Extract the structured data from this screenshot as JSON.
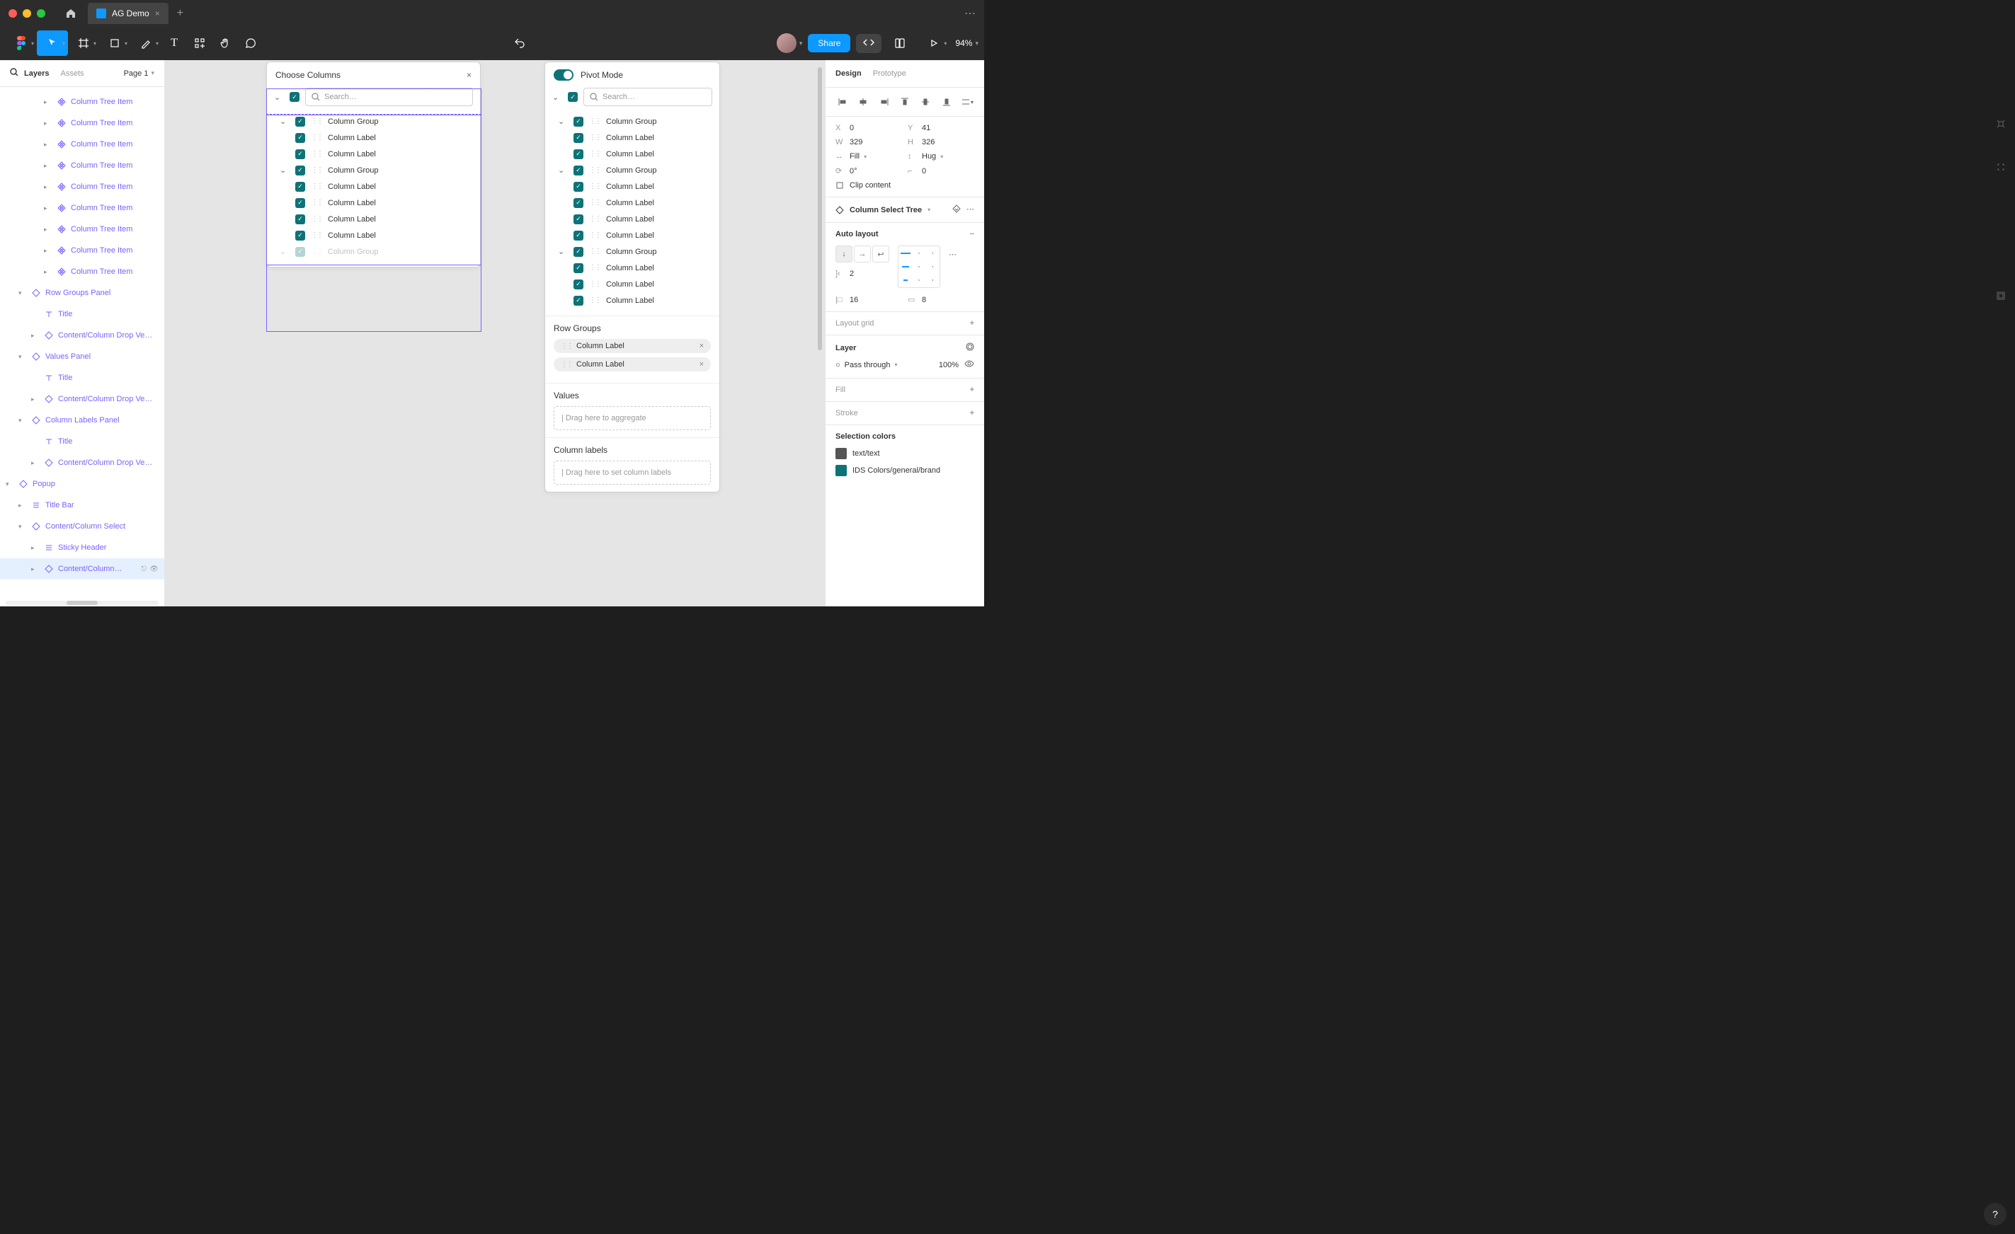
{
  "tab": {
    "title": "AG Demo"
  },
  "toolbar": {
    "share": "Share",
    "zoom": "94%"
  },
  "left_panel": {
    "tabs": {
      "layers": "Layers",
      "assets": "Assets"
    },
    "page": "Page 1",
    "layers": [
      {
        "indent": 3,
        "icon": "component",
        "label": "Column Tree Item",
        "caret": true
      },
      {
        "indent": 3,
        "icon": "component",
        "label": "Column Tree Item",
        "caret": true
      },
      {
        "indent": 3,
        "icon": "component",
        "label": "Column Tree Item",
        "caret": true
      },
      {
        "indent": 3,
        "icon": "component",
        "label": "Column Tree Item",
        "caret": true
      },
      {
        "indent": 3,
        "icon": "component",
        "label": "Column Tree Item",
        "caret": true
      },
      {
        "indent": 3,
        "icon": "component",
        "label": "Column Tree Item",
        "caret": true
      },
      {
        "indent": 3,
        "icon": "component",
        "label": "Column Tree Item",
        "caret": true
      },
      {
        "indent": 3,
        "icon": "component",
        "label": "Column Tree Item",
        "caret": true
      },
      {
        "indent": 3,
        "icon": "component",
        "label": "Column Tree Item",
        "caret": true
      },
      {
        "indent": 1,
        "icon": "frame-o",
        "label": "Row Groups Panel",
        "caret": true,
        "open": true
      },
      {
        "indent": 2,
        "icon": "text",
        "label": "Title"
      },
      {
        "indent": 2,
        "icon": "frame-o",
        "label": "Content/Column Drop Ve…",
        "caret": true
      },
      {
        "indent": 1,
        "icon": "frame-o",
        "label": "Values Panel",
        "caret": true,
        "open": true
      },
      {
        "indent": 2,
        "icon": "text",
        "label": "Title"
      },
      {
        "indent": 2,
        "icon": "frame-o",
        "label": "Content/Column Drop Ve…",
        "caret": true
      },
      {
        "indent": 1,
        "icon": "frame-o",
        "label": "Column Labels Panel",
        "caret": true,
        "open": true
      },
      {
        "indent": 2,
        "icon": "text",
        "label": "Title"
      },
      {
        "indent": 2,
        "icon": "frame-o",
        "label": "Content/Column Drop Ve…",
        "caret": true
      },
      {
        "indent": 0,
        "icon": "frame-o",
        "label": "Popup",
        "caret": true,
        "open": true
      },
      {
        "indent": 1,
        "icon": "autolayout",
        "label": "Title Bar",
        "caret": true
      },
      {
        "indent": 1,
        "icon": "frame-o",
        "label": "Content/Column Select",
        "caret": true,
        "open": true
      },
      {
        "indent": 2,
        "icon": "autolayout",
        "label": "Sticky Header",
        "caret": true
      },
      {
        "indent": 2,
        "icon": "frame-o",
        "label": "Content/Column…",
        "caret": true,
        "selected": true,
        "actions": true
      }
    ]
  },
  "canvas": {
    "choose_panel": {
      "title": "Choose Columns",
      "search_placeholder": "Search…",
      "rows": [
        {
          "type": "group",
          "label": "Column Group"
        },
        {
          "type": "item",
          "label": "Column Label"
        },
        {
          "type": "item",
          "label": "Column Label"
        },
        {
          "type": "group",
          "label": "Column Group"
        },
        {
          "type": "item",
          "label": "Column Label"
        },
        {
          "type": "item",
          "label": "Column Label"
        },
        {
          "type": "item",
          "label": "Column Label"
        },
        {
          "type": "item",
          "label": "Column Label"
        },
        {
          "type": "group_cut",
          "label": "Column Group"
        }
      ]
    },
    "pivot_panel": {
      "title": "Pivot Mode",
      "search_placeholder": "Search…",
      "rows": [
        {
          "type": "group",
          "label": "Column Group"
        },
        {
          "type": "item",
          "label": "Column Label"
        },
        {
          "type": "item",
          "label": "Column Label"
        },
        {
          "type": "group",
          "label": "Column Group"
        },
        {
          "type": "item",
          "label": "Column Label"
        },
        {
          "type": "item",
          "label": "Column Label"
        },
        {
          "type": "item",
          "label": "Column Label"
        },
        {
          "type": "item",
          "label": "Column Label"
        },
        {
          "type": "group",
          "label": "Column Group"
        },
        {
          "type": "item",
          "label": "Column Label"
        },
        {
          "type": "item",
          "label": "Column Label"
        },
        {
          "type": "item",
          "label": "Column Label"
        }
      ],
      "row_groups": {
        "title": "Row Groups",
        "chips": [
          "Column Label",
          "Column Label"
        ]
      },
      "values": {
        "title": "Values",
        "placeholder": "Drag here to aggregate"
      },
      "column_labels": {
        "title": "Column labels",
        "placeholder": "Drag here to set column labels"
      }
    }
  },
  "right_panel": {
    "tabs": {
      "design": "Design",
      "prototype": "Prototype"
    },
    "position": {
      "x": "0",
      "y": "41",
      "w": "329",
      "h": "326"
    },
    "sizing": {
      "horiz": "Fill",
      "vert": "Hug"
    },
    "rotation": "0°",
    "radius": "0",
    "clip": "Clip content",
    "variant": "Column Select Tree",
    "autolayout": {
      "title": "Auto layout",
      "gap": "2",
      "pad_h": "16",
      "pad_v": "8"
    },
    "layout_grid": "Layout grid",
    "layer": {
      "title": "Layer",
      "blend": "Pass through",
      "opacity": "100%"
    },
    "fill": "Fill",
    "stroke": "Stroke",
    "selection_colors": {
      "title": "Selection colors",
      "colors": [
        {
          "swatch": "#555555",
          "label": "text/text"
        },
        {
          "swatch": "#0d7377",
          "label": "IDS Colors/general/brand"
        }
      ]
    }
  }
}
